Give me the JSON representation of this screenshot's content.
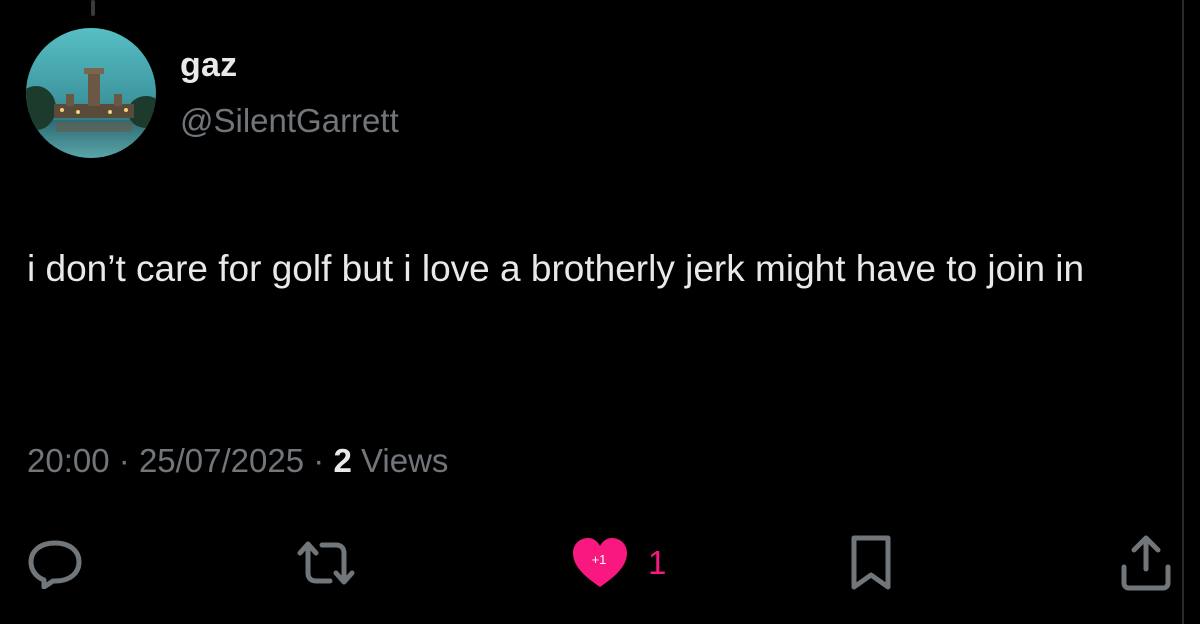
{
  "tweet": {
    "author": {
      "display_name": "gaz",
      "handle": "@SilentGarrett",
      "avatar_icon": "avatar-photo"
    },
    "text": "i don’t care for golf but i love a brotherly jerk might have to join in",
    "time": "20:00",
    "date": "25/07/2025",
    "separator": "·",
    "views_count": "2",
    "views_label": "Views"
  },
  "actions": {
    "reply_icon": "reply-icon",
    "retweet_icon": "retweet-icon",
    "like_icon": "heart-icon",
    "like_badge": "+1",
    "like_count": "1",
    "bookmark_icon": "bookmark-icon",
    "share_icon": "share-icon"
  },
  "colors": {
    "background": "#000000",
    "primary_text": "#e7e9ea",
    "secondary_text": "#71767b",
    "like_pink": "#f91880"
  }
}
